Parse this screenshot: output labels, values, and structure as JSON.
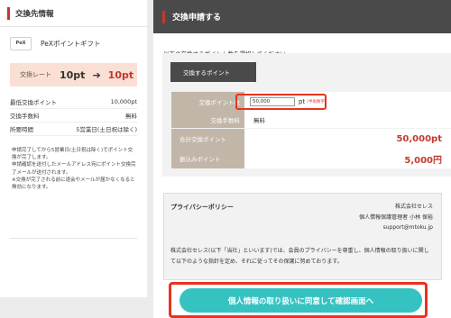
{
  "left": {
    "title": "交換先情報",
    "brand": {
      "logo_text": "PeX",
      "name": "PeXポイントギフト"
    },
    "rate": {
      "label": "交換レート",
      "from": "10pt",
      "arrow": "➔",
      "to": "10pt"
    },
    "info": [
      {
        "label": "最低交換ポイント",
        "value": "10,000pt"
      },
      {
        "label": "交換手数料",
        "value": "無料"
      },
      {
        "label": "所要時間",
        "value": "5営業日(土日祝は除く)"
      }
    ],
    "notes": [
      "申請完了してから5営業日(土日祝は除く)でポイント交換が完了します。",
      "申請確認を送付したメールアドレス宛にポイント交換完了メールが送付されます。",
      "※交換が完了される前に退会やメールが届かなくなると無効になります。"
    ]
  },
  "right": {
    "title": "交換申請する",
    "intro": "以下の交換するポイント数を選択してください。",
    "form_tab": "交換するポイント",
    "rows": {
      "points_label": "交換ポイント数",
      "points_value": "50,000",
      "points_unit": "pt",
      "points_hint": "(半角数字)",
      "fee_label": "交換手数料",
      "fee_value": "無料",
      "total_label": "合計交換ポイント",
      "total_value": "50,000pt",
      "amount_label": "振込みポイント",
      "amount_value": "5,000円"
    },
    "privacy": {
      "title": "プライバシーポリシー",
      "company": "株式会社セレス",
      "manager": "個人情報保護管理者 小林 保裕",
      "email": "support@mtoku.jp",
      "body": "株式会社セレス(以下「当社」といいます)では、会員のプライバシーを尊重し、個人情報の取り扱いに関して以下のような指針を定め、それに従ってその保護に努めております。"
    },
    "cta": "個人情報の取り扱いに同意して確認画面へ"
  },
  "colors": {
    "accent_red": "#c23a2e",
    "highlight_outline": "#e8341c",
    "cta_teal": "#37c2c2",
    "rate_bg": "#fadfd5",
    "label_bg": "#c1b6a8",
    "header_dark": "#4a4a4a"
  }
}
